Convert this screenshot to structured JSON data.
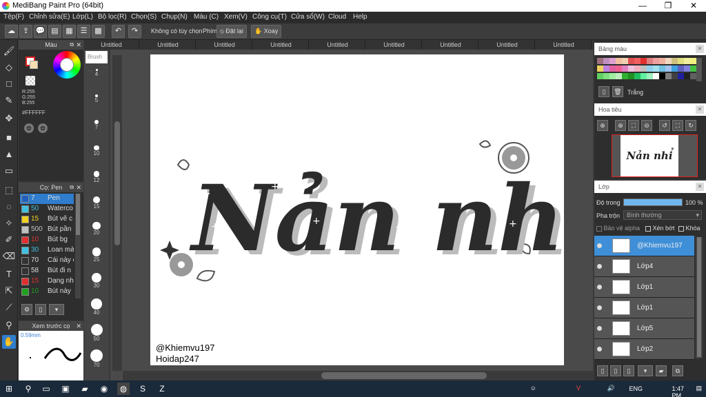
{
  "window": {
    "title": "MediBang Paint Pro (64bit)",
    "minimize": "—",
    "maximize": "❐",
    "close": "✕"
  },
  "menu": [
    "Tệp(F)",
    "Chỉnh sửa(E)",
    "Lớp(L)",
    "Bộ lọc(R)",
    "Chọn(S)",
    "Chụp(N)",
    "Màu (C)",
    "Xem(V)",
    "Công cụ(T)",
    "Cửa sổ(W)",
    "Cloud",
    "Help"
  ],
  "toolbar": {
    "option_label": "Không có tùy chọn",
    "key_label": "Phím",
    "reset_label": "Đặt lại",
    "rotate_label": "Xoay"
  },
  "tabs": [
    "Untitled",
    "Untitled",
    "Untitled",
    "Untitled",
    "Untitled",
    "Untitled",
    "Untitled",
    "Untitled",
    "Untitled"
  ],
  "color_panel": {
    "title": "Màu",
    "rgb_r": "R:255",
    "rgb_g": "G:255",
    "rgb_b": "B:255",
    "hex": "#FFFFFF",
    "primary_color": "#e02020",
    "secondary_color": "#f5deb3"
  },
  "brush_panel": {
    "title": "Cọ: Pen",
    "brushes": [
      {
        "size": "7",
        "name": "Pen",
        "color": "#2060c0"
      },
      {
        "size": "50",
        "name": "Waterco",
        "color": "#40c0e0"
      },
      {
        "size": "15",
        "name": "Bút vẽ c",
        "color": "#f0d020"
      },
      {
        "size": "500",
        "name": "Bút pần",
        "color": "#c0c0c0"
      },
      {
        "size": "10",
        "name": "Bút bg",
        "color": "#e03030"
      },
      {
        "size": "30",
        "name": "Loan mà",
        "color": "#40c0e0"
      },
      {
        "size": "70",
        "name": "Cái này c",
        "color": "#333333"
      },
      {
        "size": "58",
        "name": "Bút đi n",
        "color": "#333333"
      },
      {
        "size": "15",
        "name": "Dạng nh",
        "color": "#e03030"
      },
      {
        "size": "10",
        "name": "Bút này",
        "color": "#20a020"
      }
    ]
  },
  "preview_panel": {
    "title": "Xem trước cọ",
    "size_label": "0.59mm"
  },
  "brush_size": {
    "header": "Brush ...",
    "sizes": [
      "4",
      "5",
      "7",
      "10",
      "12",
      "15",
      "20",
      "25",
      "30",
      "40",
      "50",
      "70"
    ]
  },
  "canvas": {
    "lettering": "Nản nhỉ",
    "credit_line1": "@Khiemvu197",
    "credit_line2": "Hoidap247"
  },
  "palette_panel": {
    "title": "Bảng màu",
    "label": "Trắng",
    "colors": [
      "#a07080",
      "#c090c0",
      "#e0a0d0",
      "#f0c0a0",
      "#f0d0b0",
      "#e05050",
      "#f06060",
      "#e03030",
      "#e08080",
      "#f0a0a0",
      "#f0b0a0",
      "#f0d8c0",
      "#d0c080",
      "#e0e080",
      "#f0f0a0",
      "#f0f080",
      "#f0d060",
      "#c080e0",
      "#e060a0",
      "#f06090",
      "#e080c0",
      "#f0c0e0",
      "#f0b0c0",
      "#c0c0c0",
      "#90d0f0",
      "#a0e0f0",
      "#70c0e0",
      "#a0c0f0",
      "#40a0e0",
      "#6060c0",
      "#8080e0",
      "#40c040",
      "#60d060",
      "#80e080",
      "#a0f0a0",
      "#c0f0c0",
      "#30b030",
      "#209020",
      "#20c060",
      "#60f0a0",
      "#a0f0c0",
      "#ffffff",
      "#000000",
      "#808080",
      "#404040",
      "#2020a0",
      "#202020",
      "#606060"
    ]
  },
  "nav_panel": {
    "title": "Hoa tiêu",
    "thumb_text": "Nản nhỉ"
  },
  "layer_panel": {
    "title": "Lớp",
    "opacity_label": "Độ trong",
    "opacity_value": "100 %",
    "opacity_fraction": 1.0,
    "blend_label": "Pha trộn",
    "blend_value": "Bình thường",
    "protect_alpha": "Bảo vệ alpha",
    "clipping": "Xén bớt",
    "lock": "Khóa",
    "layers": [
      {
        "name": "@Khiemvu197",
        "selected": true
      },
      {
        "name": "Lớp4",
        "selected": false
      },
      {
        "name": "Lớp1",
        "selected": false
      },
      {
        "name": "Lớp1",
        "selected": false
      },
      {
        "name": "Lớp5",
        "selected": false
      },
      {
        "name": "Lớp2",
        "selected": false
      }
    ]
  },
  "taskbar": {
    "time": "1:47 PM",
    "lang": "ENG"
  }
}
